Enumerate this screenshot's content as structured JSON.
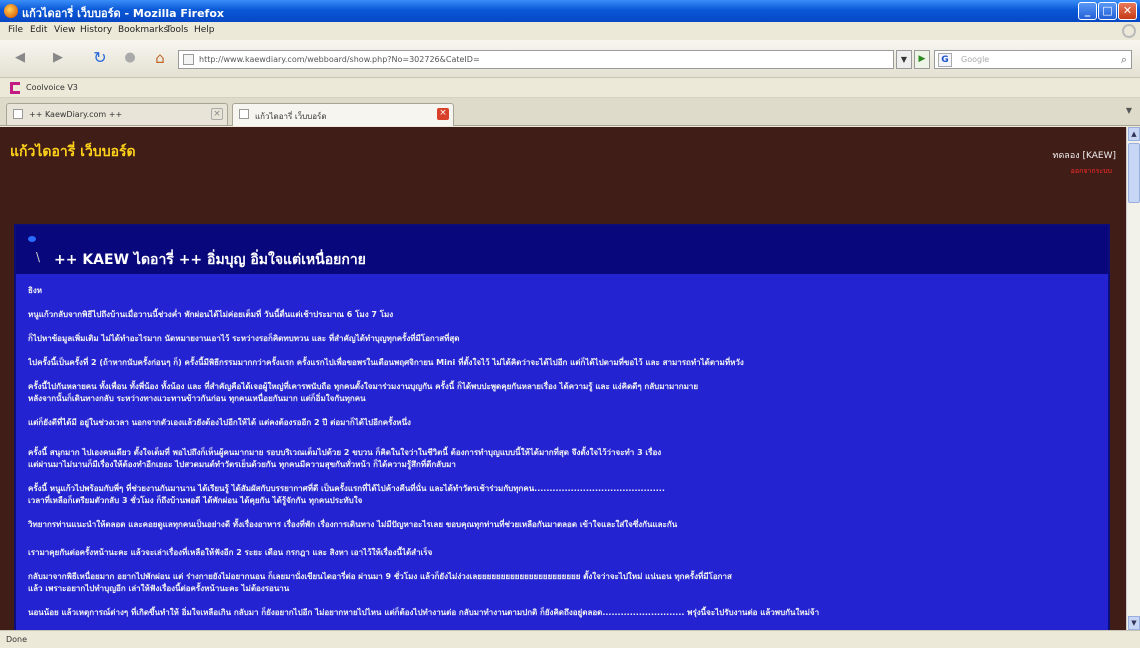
{
  "window": {
    "title": "แก้วไดอารี่ เว็บบอร์ด - Mozilla Firefox",
    "controls": [
      "_",
      "□",
      "✕"
    ]
  },
  "menu": [
    "File",
    "Edit",
    "View",
    "History",
    "Bookmarks",
    "Tools",
    "Help"
  ],
  "nav": {
    "url": "http://www.kaewdiary.com/webboard/show.php?No=302726&CateID=",
    "search_placeholder": "Google",
    "search_engine": "G"
  },
  "bookmarks": [
    {
      "label": "Coolvoice V3",
      "icon": "coolvoice-icon"
    }
  ],
  "tabs": [
    {
      "label": "++ KaewDiary.com ++",
      "active": false
    },
    {
      "label": "แก้วไดอารี่ เว็บบอร์ด",
      "active": true
    }
  ],
  "page": {
    "site_title": "แก้วไดอารี่ เว็บบอร์ด",
    "member": "ทดลอง [KAEW]",
    "member_link": "ออกจากระบบ",
    "post": {
      "title": "++ KAEW ไดอารี่ ++ อิ่มบุญ อิ่มใจแต่เหนื่อยกาย",
      "lines": [
        "ธิงห",
        "หนูแก้วกลับจากพิธีไปถึงบ้านเมื่อวานนี้ช่วงค่ำ พักผ่อนได้ไม่ค่อยเต็มที่ วันนี้ตื่นแต่เช้าประมาณ 6 โมง 7 โมง",
        "ก็ไปหาข้อมูลเพิ่มเติม ไม่ได้ทำอะไรมาก นัดหมายงานเอาไว้ ระหว่างรอก็คิดทบทวน และ ที่สำคัญได้ทำบุญทุกครั้งที่มีโอกาสที่สุด",
        "ไปครั้งนี้เป็นครั้งที่ 2 (ถ้าหากนับครั้งก่อนๆ ก็) ครั้งนี้มีพิธีกรรมมากกว่าครั้งแรก ครั้งแรกไปเพื่อขอพรในเดือนพฤศจิกายน Mini ที่ตั้งใจไว้ ไม่ได้คิดว่าจะได้ไปอีก แต่ก็ได้ไปตามที่ขอไว้ และ สามารถทำได้ตามที่หวัง",
        "ครั้งนี้ไปกันหลายคน ทั้งเพื่อน ทั้งพี่น้อง ทั้งน้อง และ ที่สำคัญคือได้เจอผู้ใหญ่ที่เคารพนับถือ ทุกคนตั้งใจมาร่วมงานบุญกัน ครั้งนี้ ก็ได้พบปะพูดคุยกันหลายเรื่อง ได้ความรู้ และ แง่คิดดีๆ กลับมามากมาย",
        "หลังจากนั้นก็เดินทางกลับ ระหว่างทางแวะทานข้าวกันก่อน ทุกคนเหนื่อยกันมาก แต่ก็อิ่มใจกันทุกคน",
        "แต่ก็ยังดีที่ได้มี อยู่ในช่วงเวลา นอกจากตัวเองแล้วยังต้องไปอีกให้ได้ แต่คงต้องรออีก 2 ปี ต่อมาก็ได้ไปอีกครั้งหนึ่ง",
        "ครั้งนี้ สนุกมาก ไปเองคนเดียว ตั้งใจเต็มที่ พอไปถึงก็เห็นผู้คนมากมาย รอบบริเวณเต็มไปด้วย 2 ขบวน ก็คิดในใจว่าในชีวิตนี้ ต้องการทำบุญแบบนี้ให้ได้มากที่สุด จึงตั้งใจไว้ว่าจะทำ 3 เรื่อง",
        "แต่ผ่านมาไม่นานก็มีเรื่องให้ต้องทำอีกเยอะ ไปสวดมนต์ทำวัตรเย็นด้วยกัน ทุกคนมีความสุขกันทั่วหน้า ก็ได้ความรู้สึกที่ดีกลับมา",
        "ครั้งนี้ หนูแก้วไปพร้อมกับพี่ๆ ที่ช่วยงานกันมานาน ได้เรียนรู้ ได้สัมผัสกับบรรยากาศที่ดี เป็นครั้งแรกที่ได้ไปค้างคืนที่นั่น และได้ทำวัตรเช้าร่วมกับทุกคน...........................................",
        "เวลาที่เหลือก็เตรียมตัวกลับ 3 ชั่วโมง ก็ถึงบ้านพอดี ได้พักผ่อน ได้คุยกัน ได้รู้จักกัน ทุกคนประทับใจ",
        "วิทยากรท่านแนะนำให้ตลอด และคอยดูแลทุกคนเป็นอย่างดี ทั้งเรื่องอาหาร เรื่องที่พัก เรื่องการเดินทาง ไม่มีปัญหาอะไรเลย ขอบคุณทุกท่านที่ช่วยเหลือกันมาตลอด เข้าใจและใส่ใจซึ่งกันและกัน",
        "เรามาคุยกันต่อครั้งหน้านะคะ แล้วจะเล่าเรื่องที่เหลือให้ฟังอีก 2 ระยะ เดือน กรกฎา และ สิงหา เอาไว้ให้เรื่องนี้ได้สำเร็จ",
        "กลับมาจากพิธีเหนื่อยมาก อยากไปพักผ่อน แต่ ร่างกายยังไม่อยากนอน ก็เลยมานั่งเขียนไดอารี่ต่อ ผ่านมา 9 ชั่วโมง แล้วก็ยังไม่ง่วงเลยยยยยยยยยยยยยยยยยยยยยย ตั้งใจว่าจะไปใหม่ แน่นอน ทุกครั้งที่มีโอกาส",
        "แล้ว เพราะอยากไปทำบุญอีก เล่าให้ฟังเรื่องนี้ต่อครั้งหน้านะคะ ไม่ต้องรอนาน",
        "นอนน้อย แล้วเหตุการณ์ต่างๆ ที่เกิดขึ้นทำให้ อิ่มใจเหลือเกิน กลับมา ก็ยังอยากไปอีก ไม่อยากหายไปไหน แต่ก็ต้องไปทำงานต่อ กลับมาทำงานตามปกติ ก็ยังคิดถึงอยู่ตลอด...........................  พรุ่งนี้จะไปรับงานต่อ แล้วพบกันใหม่จ้า"
      ]
    }
  },
  "status": "Done"
}
